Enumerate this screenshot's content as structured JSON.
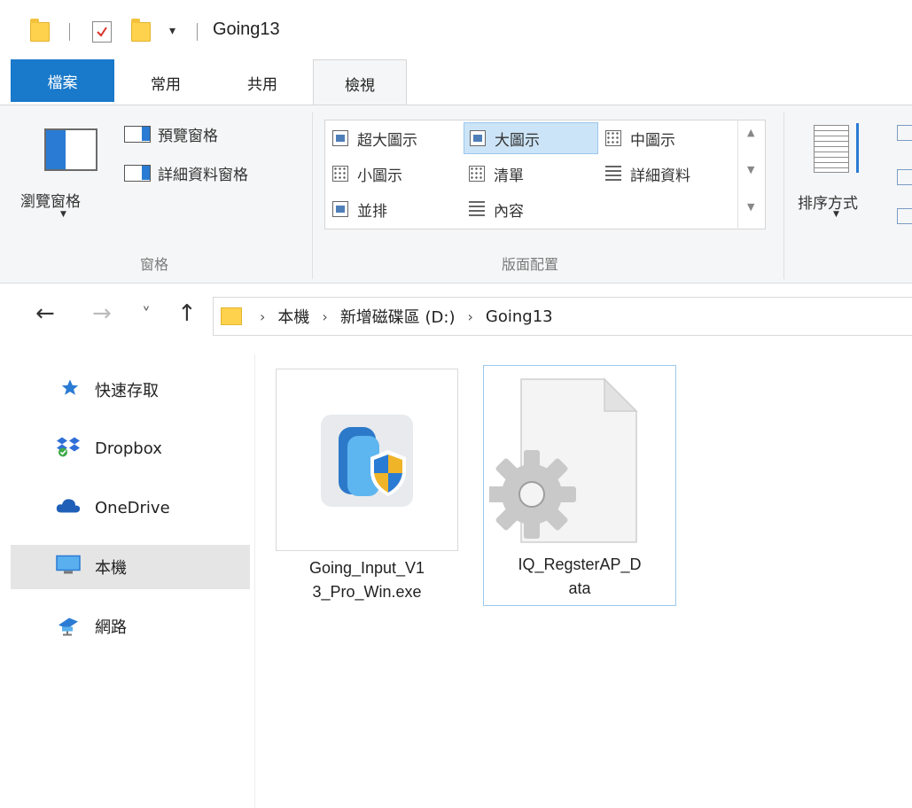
{
  "titlebar": {
    "title": "Going13",
    "dropdown_glyph": "▾"
  },
  "ribbon_tabs": {
    "file": "檔案",
    "home": "常用",
    "share": "共用",
    "view": "檢視"
  },
  "ribbon": {
    "panes": {
      "nav_pane": "瀏覽窗格",
      "preview_pane": "預覽窗格",
      "details_pane": "詳細資料窗格",
      "group_label": "窗格"
    },
    "layout": {
      "items": [
        "超大圖示",
        "大圖示",
        "中圖示",
        "小圖示",
        "清單",
        "詳細資料",
        "並排",
        "內容"
      ],
      "selected": "大圖示",
      "group_label": "版面配置"
    },
    "sort": {
      "label": "排序方式"
    }
  },
  "address": {
    "back": "←",
    "forward": "→",
    "recent": "˅",
    "up": "↑",
    "parts": [
      "本機",
      "新增磁碟區 (D:)",
      "Going13"
    ],
    "separator": "›"
  },
  "sidebar": {
    "items": [
      {
        "label": "快速存取",
        "icon": "star-icon"
      },
      {
        "label": "Dropbox",
        "icon": "dropbox-icon"
      },
      {
        "label": "OneDrive",
        "icon": "cloud-icon"
      },
      {
        "label": "本機",
        "icon": "computer-icon",
        "active": true
      },
      {
        "label": "網路",
        "icon": "network-icon"
      }
    ]
  },
  "files": [
    {
      "name": "Going_Input_V13_Pro_Win.exe",
      "line1": "Going_Input_V1",
      "line2": "3_Pro_Win.exe",
      "icon": "installer-shield-icon"
    },
    {
      "name": "IQ_RegsterAP_Data",
      "line1": "IQ_RegsterAP_D",
      "line2": "ata",
      "icon": "gear-file-icon",
      "selected": true
    }
  ],
  "colors": {
    "accent": "#1979ca",
    "selection": "#cce4f7",
    "folder": "#ffd24d"
  }
}
